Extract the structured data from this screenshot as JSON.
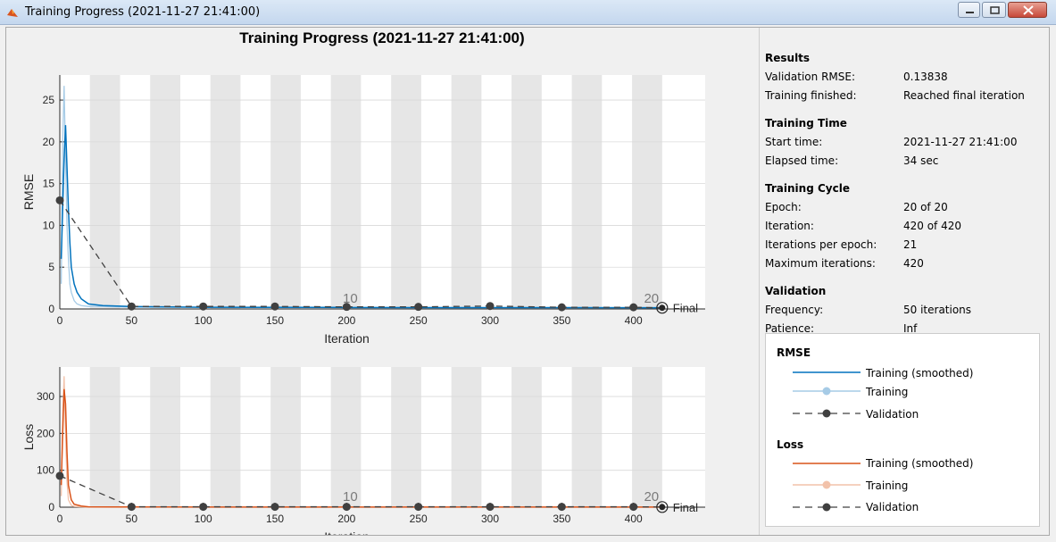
{
  "window": {
    "title": "Training Progress (2021-11-27 21:41:00)"
  },
  "plot": {
    "title": "Training Progress (2021-11-27 21:41:00)"
  },
  "results": {
    "heading": "Results",
    "rows": [
      {
        "label": "Validation RMSE:",
        "value": "0.13838"
      },
      {
        "label": "Training finished:",
        "value": "Reached final iteration"
      }
    ]
  },
  "training_time": {
    "heading": "Training Time",
    "rows": [
      {
        "label": "Start time:",
        "value": "2021-11-27 21:41:00"
      },
      {
        "label": "Elapsed time:",
        "value": "34 sec"
      }
    ]
  },
  "training_cycle": {
    "heading": "Training Cycle",
    "rows": [
      {
        "label": "Epoch:",
        "value": "20 of 20"
      },
      {
        "label": "Iteration:",
        "value": "420 of 420"
      },
      {
        "label": "Iterations per epoch:",
        "value": "21"
      },
      {
        "label": "Maximum iterations:",
        "value": "420"
      }
    ]
  },
  "validation": {
    "heading": "Validation",
    "rows": [
      {
        "label": "Frequency:",
        "value": "50 iterations"
      },
      {
        "label": "Patience:",
        "value": "Inf"
      }
    ]
  },
  "legend": {
    "rmse_heading": "RMSE",
    "loss_heading": "Loss",
    "training_smoothed": "Training (smoothed)",
    "training": "Training",
    "validation": "Validation"
  },
  "colors": {
    "rmse_smoothed": "#0072bd",
    "rmse_training": "#a6cbe6",
    "loss_smoothed": "#d95319",
    "loss_training": "#f2c2aa",
    "validation": "#404040",
    "epoch_band": "#e6e6e6"
  },
  "chart_data": [
    {
      "type": "line",
      "xlabel": "Iteration",
      "ylabel": "RMSE",
      "xlim": [
        0,
        450
      ],
      "ylim": [
        0,
        28
      ],
      "xticks": [
        0,
        50,
        100,
        150,
        200,
        250,
        300,
        350,
        400
      ],
      "yticks": [
        0,
        5,
        10,
        15,
        20,
        25
      ],
      "epoch_labels": [
        {
          "epoch": "10",
          "x": 210
        },
        {
          "epoch": "20",
          "x": 420
        }
      ],
      "final_label": "Final",
      "series": [
        {
          "name": "Training (smoothed)",
          "x": [
            1,
            2,
            3,
            4,
            5,
            6,
            7,
            8,
            10,
            12,
            15,
            20,
            30,
            50,
            100,
            200,
            300,
            420
          ],
          "y": [
            6,
            12,
            18,
            22,
            17,
            12,
            8,
            5,
            3,
            2,
            1.2,
            0.6,
            0.4,
            0.3,
            0.2,
            0.18,
            0.16,
            0.15
          ]
        },
        {
          "name": "Training",
          "x": [
            1,
            2,
            3,
            4,
            5,
            6,
            7,
            8,
            10,
            12,
            15,
            20,
            30,
            50,
            100,
            200,
            300,
            420
          ],
          "y": [
            3,
            20,
            26.7,
            18,
            10,
            6,
            3,
            2,
            1,
            0.6,
            0.4,
            0.3,
            0.3,
            0.2,
            0.2,
            0.15,
            0.15,
            0.14
          ]
        },
        {
          "name": "Validation",
          "x": [
            0,
            50,
            100,
            150,
            200,
            250,
            300,
            350,
            400,
            420
          ],
          "y": [
            13,
            0.3,
            0.3,
            0.3,
            0.25,
            0.25,
            0.35,
            0.2,
            0.2,
            0.14
          ]
        }
      ]
    },
    {
      "type": "line",
      "xlabel": "Iteration",
      "ylabel": "Loss",
      "xlim": [
        0,
        450
      ],
      "ylim": [
        0,
        380
      ],
      "xticks": [
        0,
        50,
        100,
        150,
        200,
        250,
        300,
        350,
        400
      ],
      "yticks": [
        0,
        100,
        200,
        300
      ],
      "epoch_labels": [
        {
          "epoch": "10",
          "x": 210
        },
        {
          "epoch": "20",
          "x": 420
        }
      ],
      "final_label": "Final",
      "series": [
        {
          "name": "Training (smoothed)",
          "x": [
            1,
            2,
            3,
            4,
            5,
            6,
            8,
            10,
            15,
            20,
            50,
            420
          ],
          "y": [
            60,
            200,
            320,
            280,
            150,
            60,
            20,
            8,
            3,
            1,
            0.5,
            0.2
          ]
        },
        {
          "name": "Training",
          "x": [
            1,
            2,
            3,
            4,
            5,
            6,
            8,
            10,
            15,
            20,
            50,
            420
          ],
          "y": [
            30,
            250,
            355,
            200,
            70,
            20,
            5,
            2,
            1,
            0.5,
            0.3,
            0.2
          ]
        },
        {
          "name": "Validation",
          "x": [
            0,
            50,
            100,
            150,
            200,
            250,
            300,
            350,
            400,
            420
          ],
          "y": [
            85,
            1,
            1,
            1,
            1,
            1,
            1,
            1,
            1,
            0.5
          ]
        }
      ]
    }
  ]
}
